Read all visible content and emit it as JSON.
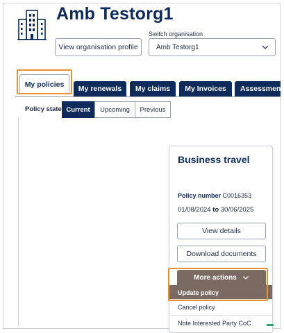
{
  "header": {
    "org_title": "Amb Testorg1",
    "view_profile_label": "View organisation profile",
    "switch_label": "Switch organisation",
    "switch_value": "Amb Testorg1"
  },
  "tabs": [
    {
      "label": "My policies",
      "active": true
    },
    {
      "label": "My renewals",
      "active": false
    },
    {
      "label": "My claims",
      "active": false
    },
    {
      "label": "My Invoices",
      "active": false
    },
    {
      "label": "Assessment",
      "active": false
    }
  ],
  "policy_state": {
    "label": "Policy state",
    "options": [
      "Current",
      "Upcoming",
      "Previous"
    ],
    "selected": "Current"
  },
  "policy_card": {
    "title": "Business travel",
    "policy_number_label": "Policy number",
    "policy_number": "C0016353",
    "start_date": "01/08/2024",
    "to_word": "to",
    "end_date": "30/06/2025",
    "view_details_label": "View details",
    "download_label": "Download documents",
    "more_actions_label": "More actions",
    "actions": [
      "Update policy",
      "Cancel policy",
      "Note Interested Party CoC"
    ]
  },
  "colors": {
    "navy": "#0f2b5b",
    "highlight": "#e8912e",
    "dropdown_hover": "#7a6a62",
    "accent_green": "#2aa36b"
  },
  "icons": {
    "org": "building-icon",
    "select": "chevron-down-icon",
    "more": "chevron-down-icon"
  }
}
